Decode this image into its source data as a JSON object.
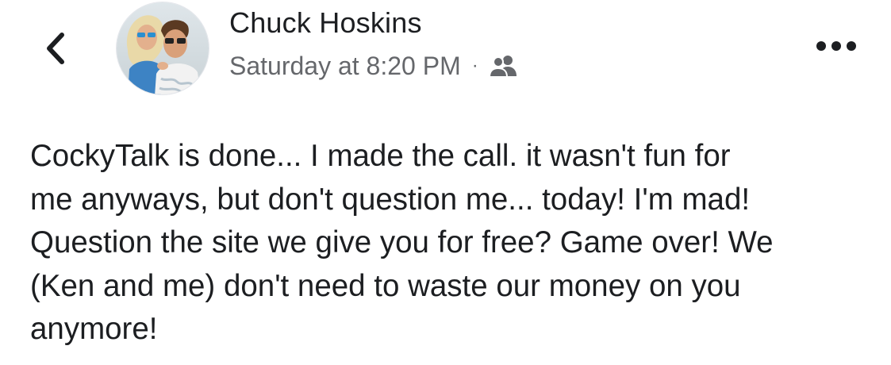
{
  "header": {
    "back_icon": "chevron-left-icon",
    "author_name": "Chuck Hoskins",
    "timestamp": "Saturday at 8:20 PM",
    "separator": "·",
    "audience_icon": "friends-icon",
    "more_icon": "more-horizontal-icon"
  },
  "post": {
    "lines": [
      "CockyTalk is done... I made the call. it wasn't fun for",
      "me anyways, but don't question me... today! I'm mad!",
      "Question the site we give you for free? Game over! We",
      "(Ken and me) don't need to waste our money on you",
      "anymore!"
    ]
  },
  "colors": {
    "primary_text": "#1c1e21",
    "secondary_text": "#65676b",
    "icon": "#1c1e21"
  }
}
